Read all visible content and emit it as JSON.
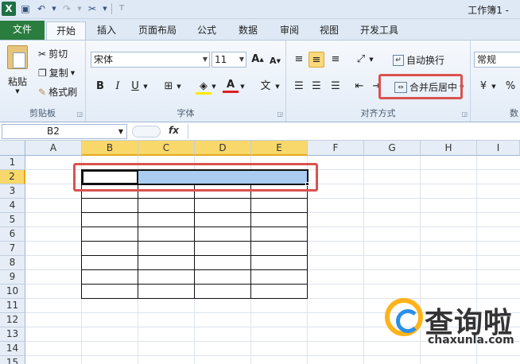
{
  "window": {
    "title": "工作簿1 -"
  },
  "qat": {
    "icons": [
      "excel-logo-icon",
      "save-icon",
      "undo-icon",
      "redo-icon",
      "customize-icon"
    ]
  },
  "tabs": [
    {
      "label": "文件"
    },
    {
      "label": "开始"
    },
    {
      "label": "插入"
    },
    {
      "label": "页面布局"
    },
    {
      "label": "公式"
    },
    {
      "label": "数据"
    },
    {
      "label": "审阅"
    },
    {
      "label": "视图"
    },
    {
      "label": "开发工具"
    }
  ],
  "clipboard": {
    "paste": "粘贴",
    "cut": "剪切",
    "copy": "复制",
    "format_painter": "格式刷",
    "group": "剪贴板"
  },
  "font": {
    "name": "宋体",
    "size": "11",
    "grow": "A",
    "shrink": "A",
    "bold": "B",
    "italic": "I",
    "underline": "U",
    "wen": "文",
    "group": "字体"
  },
  "alignment": {
    "wrap_text": "自动换行",
    "merge_center": "合并后居中",
    "group": "对齐方式"
  },
  "number": {
    "format": "常规",
    "percent": "%",
    "group": "数"
  },
  "formula_bar": {
    "name_box": "B2",
    "fx": "fx"
  },
  "columns": [
    "A",
    "B",
    "C",
    "D",
    "E",
    "F",
    "G",
    "H",
    "I"
  ],
  "rows": [
    "1",
    "2",
    "3",
    "4",
    "5",
    "6",
    "7",
    "8",
    "9",
    "10",
    "11",
    "12",
    "13",
    "14",
    "15"
  ],
  "selection": {
    "active_cell": "B2",
    "range": "B2:E2",
    "highlight_color": "#f8d86a",
    "selection_fill": "#a9ccf0"
  },
  "watermark": {
    "text": "查询啦",
    "url": "chaxunla.com"
  },
  "colors": {
    "file_tab": "#2a7d3f",
    "annotation": "#d9534f"
  }
}
